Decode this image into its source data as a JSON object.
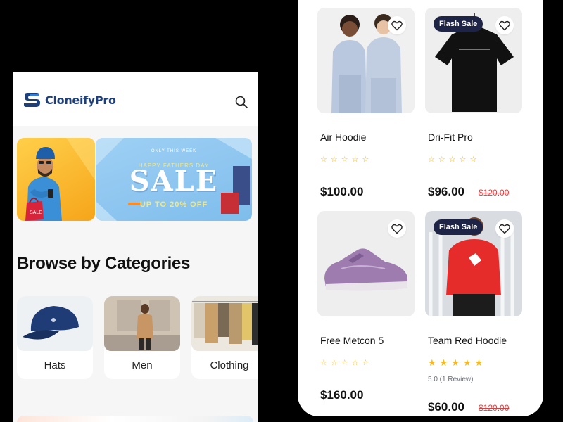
{
  "left_app": {
    "brand": "CloneifyPro",
    "banner": {
      "tag": "ONLY THIS WEEK",
      "subtitle": "HAPPY FATHERS DAY",
      "title": "SALE",
      "offer": "UP TO 20% OFF",
      "bag_text": "SALE"
    },
    "section_title": "Browse by Categories",
    "categories": [
      {
        "label": "Hats"
      },
      {
        "label": "Men"
      },
      {
        "label": "Clothing"
      }
    ]
  },
  "right_app": {
    "products": [
      {
        "name": "Air Hoodie",
        "price": "$100.00",
        "flash_sale": false,
        "stars_filled": 0
      },
      {
        "name": "Dri-Fit Pro",
        "price": "$96.00",
        "old_price": "$120.00",
        "flash_sale": true,
        "flash_label": "Flash Sale",
        "stars_filled": 0
      },
      {
        "name": "Free Metcon 5",
        "price": "$160.00",
        "flash_sale": false,
        "stars_filled": 0
      },
      {
        "name": "Team Red Hoodie",
        "price": "$60.00",
        "old_price": "$120.00",
        "flash_sale": true,
        "flash_label": "Flash Sale",
        "rating": "5.0 (1 Review)",
        "stars_filled": 5
      }
    ]
  },
  "colors": {
    "brand_navy": "#1d3f7a",
    "flash_badge": "#1e2445",
    "star": "#f6b81c",
    "strike_price": "#e23b3b"
  },
  "icons": [
    "logo-mark-icon",
    "search-icon",
    "heart-icon",
    "star-icon"
  ]
}
